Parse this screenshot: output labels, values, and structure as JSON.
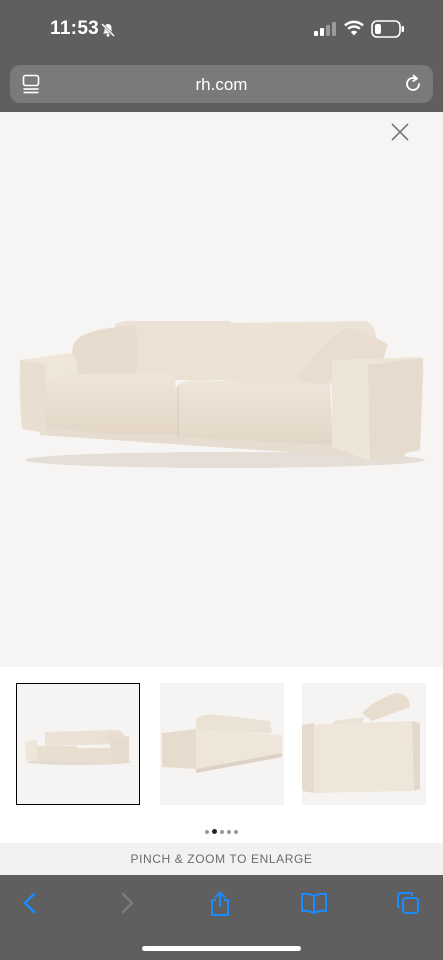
{
  "status_bar": {
    "time": "11:53",
    "icons": [
      "bell-slash-icon",
      "signal-icon",
      "wifi-icon",
      "battery-icon"
    ]
  },
  "browser": {
    "url": "rh.com",
    "icons": [
      "page-menu-icon",
      "reload-icon"
    ]
  },
  "viewer": {
    "close_icon": "close-icon",
    "thumbnails": [
      {
        "view": "front angle",
        "selected": true
      },
      {
        "view": "rear angle",
        "selected": false
      },
      {
        "view": "side view",
        "selected": false
      }
    ],
    "pagination": {
      "count": 5,
      "active_index": 1
    }
  },
  "hint": {
    "text": "PINCH & ZOOM TO ENLARGE"
  },
  "toolbar": {
    "icons": [
      "back-icon",
      "forward-icon",
      "share-icon",
      "bookmarks-icon",
      "tabs-icon"
    ]
  },
  "colors": {
    "chrome": "#5f5f5f",
    "accent": "#1a8cff",
    "background": "#f7f5f3"
  }
}
